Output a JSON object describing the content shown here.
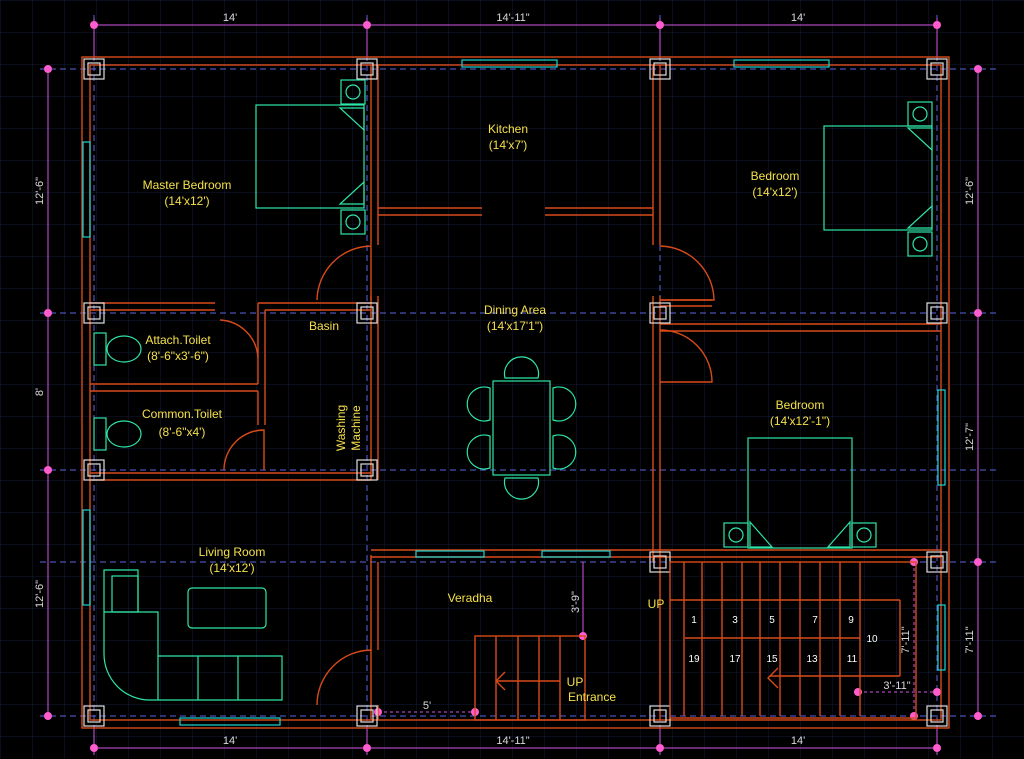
{
  "colors": {
    "background": "#000000",
    "grid": "#1a2040",
    "wall": "#d84a1a",
    "furniture": "#2ee6a8",
    "window": "#19d6d6",
    "axis": "#5a64e0",
    "dimension": "#d455e8",
    "room_text": "#f5e04a",
    "dim_text": "#d9d9d9"
  },
  "rooms": {
    "master_bedroom": {
      "name": "Master Bedroom",
      "size": "(14'x12')"
    },
    "kitchen": {
      "name": "Kitchen",
      "size": "(14'x7')"
    },
    "bedroom_1": {
      "name": "Bedroom",
      "size": "(14'x12')"
    },
    "dining": {
      "name": "Dining Area",
      "size": "(14'x17'1\")"
    },
    "basin": {
      "name": "Basin"
    },
    "attach_toilet": {
      "name": "Attach.Toilet",
      "size": "(8'-6\"x3'-6\")"
    },
    "common_toilet": {
      "name": "Common.Toilet",
      "size": "(8'-6\"x4')"
    },
    "washing": {
      "line1": "Washing",
      "line2": "Machine"
    },
    "bedroom_2": {
      "name": "Bedroom",
      "size": "(14'x12'-1\")"
    },
    "living": {
      "name": "Living Room",
      "size": "(14'x12')"
    },
    "veradha": {
      "name": "Veradha"
    },
    "entrance": {
      "up": "UP",
      "name": "Entrance"
    },
    "stair_up": "UP"
  },
  "dimensions": {
    "top": [
      "14'",
      "14'-11\"",
      "14'"
    ],
    "bottom": [
      "14'",
      "14'-11\"",
      "14'"
    ],
    "left": [
      "12'-6\"",
      "8'",
      "12'-6\""
    ],
    "right": [
      "12'-6\"",
      "12'-7\"",
      "7'-11\""
    ],
    "inner": {
      "d1": "3'-9\"",
      "d2": "5'",
      "d3": "7'-11\"",
      "d4": "3'-11\""
    }
  },
  "stairs": {
    "top_row": [
      "1",
      "3",
      "5",
      "7",
      "9"
    ],
    "bottom_row": [
      "19",
      "17",
      "15",
      "13",
      "11"
    ],
    "turn": "10"
  }
}
